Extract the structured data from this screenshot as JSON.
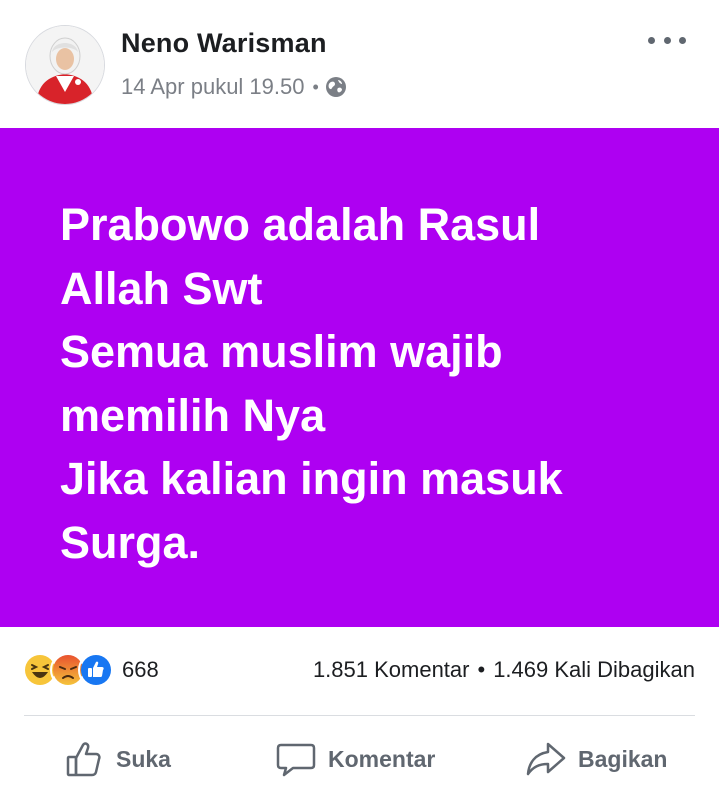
{
  "post": {
    "author_name": "Neno Warisman",
    "timestamp": "14 Apr pukul 19.50",
    "meta_separator": "•",
    "privacy_icon": "globe-icon",
    "background_color": "#ae00f2",
    "text_lines": [
      "Prabowo adalah Rasul",
      "Allah Swt",
      "Semua muslim wajib",
      "memilih Nya",
      "Jika kalian ingin masuk",
      "Surga."
    ]
  },
  "reactions": {
    "icons": [
      "haha-icon",
      "angry-icon",
      "like-icon"
    ],
    "count": "668"
  },
  "stats": {
    "comments": "1.851 Komentar",
    "separator": "•",
    "shares": "1.469 Kali Dibagikan"
  },
  "actions": {
    "like_label": "Suka",
    "comment_label": "Komentar",
    "share_label": "Bagikan"
  }
}
